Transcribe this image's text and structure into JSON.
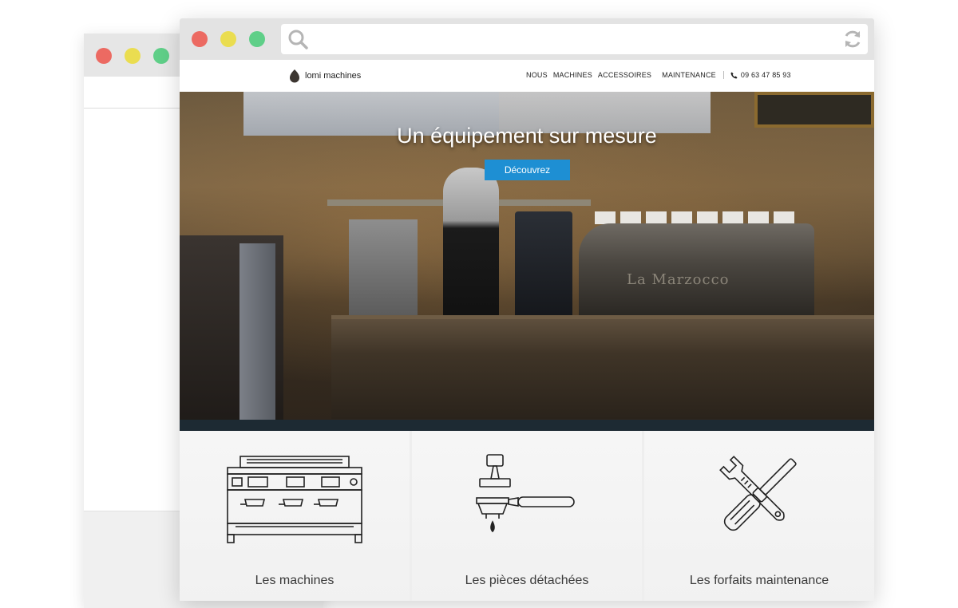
{
  "colors": {
    "close": "#ec6a62",
    "minimize": "#eadd50",
    "maximize": "#5fcf88",
    "accent": "#1e8fd3"
  },
  "browser": {
    "url": ""
  },
  "site": {
    "logo_text": "lomi machines",
    "nav": [
      {
        "label": "NOUS"
      },
      {
        "label": "MACHINES"
      },
      {
        "label": "ACCESSOIRES"
      },
      {
        "label": "MAINTENANCE"
      }
    ],
    "phone": "09 63 47 85 93"
  },
  "hero": {
    "title": "Un équipement sur mesure",
    "cta": "Découvrez",
    "machine_brand": "La Marzocco"
  },
  "categories": [
    {
      "label": "Les machines",
      "icon": "espresso-machine-icon"
    },
    {
      "label": "Les pièces détachées",
      "icon": "portafilter-tamper-icon"
    },
    {
      "label": "Les forfaits maintenance",
      "icon": "tools-icon"
    }
  ]
}
